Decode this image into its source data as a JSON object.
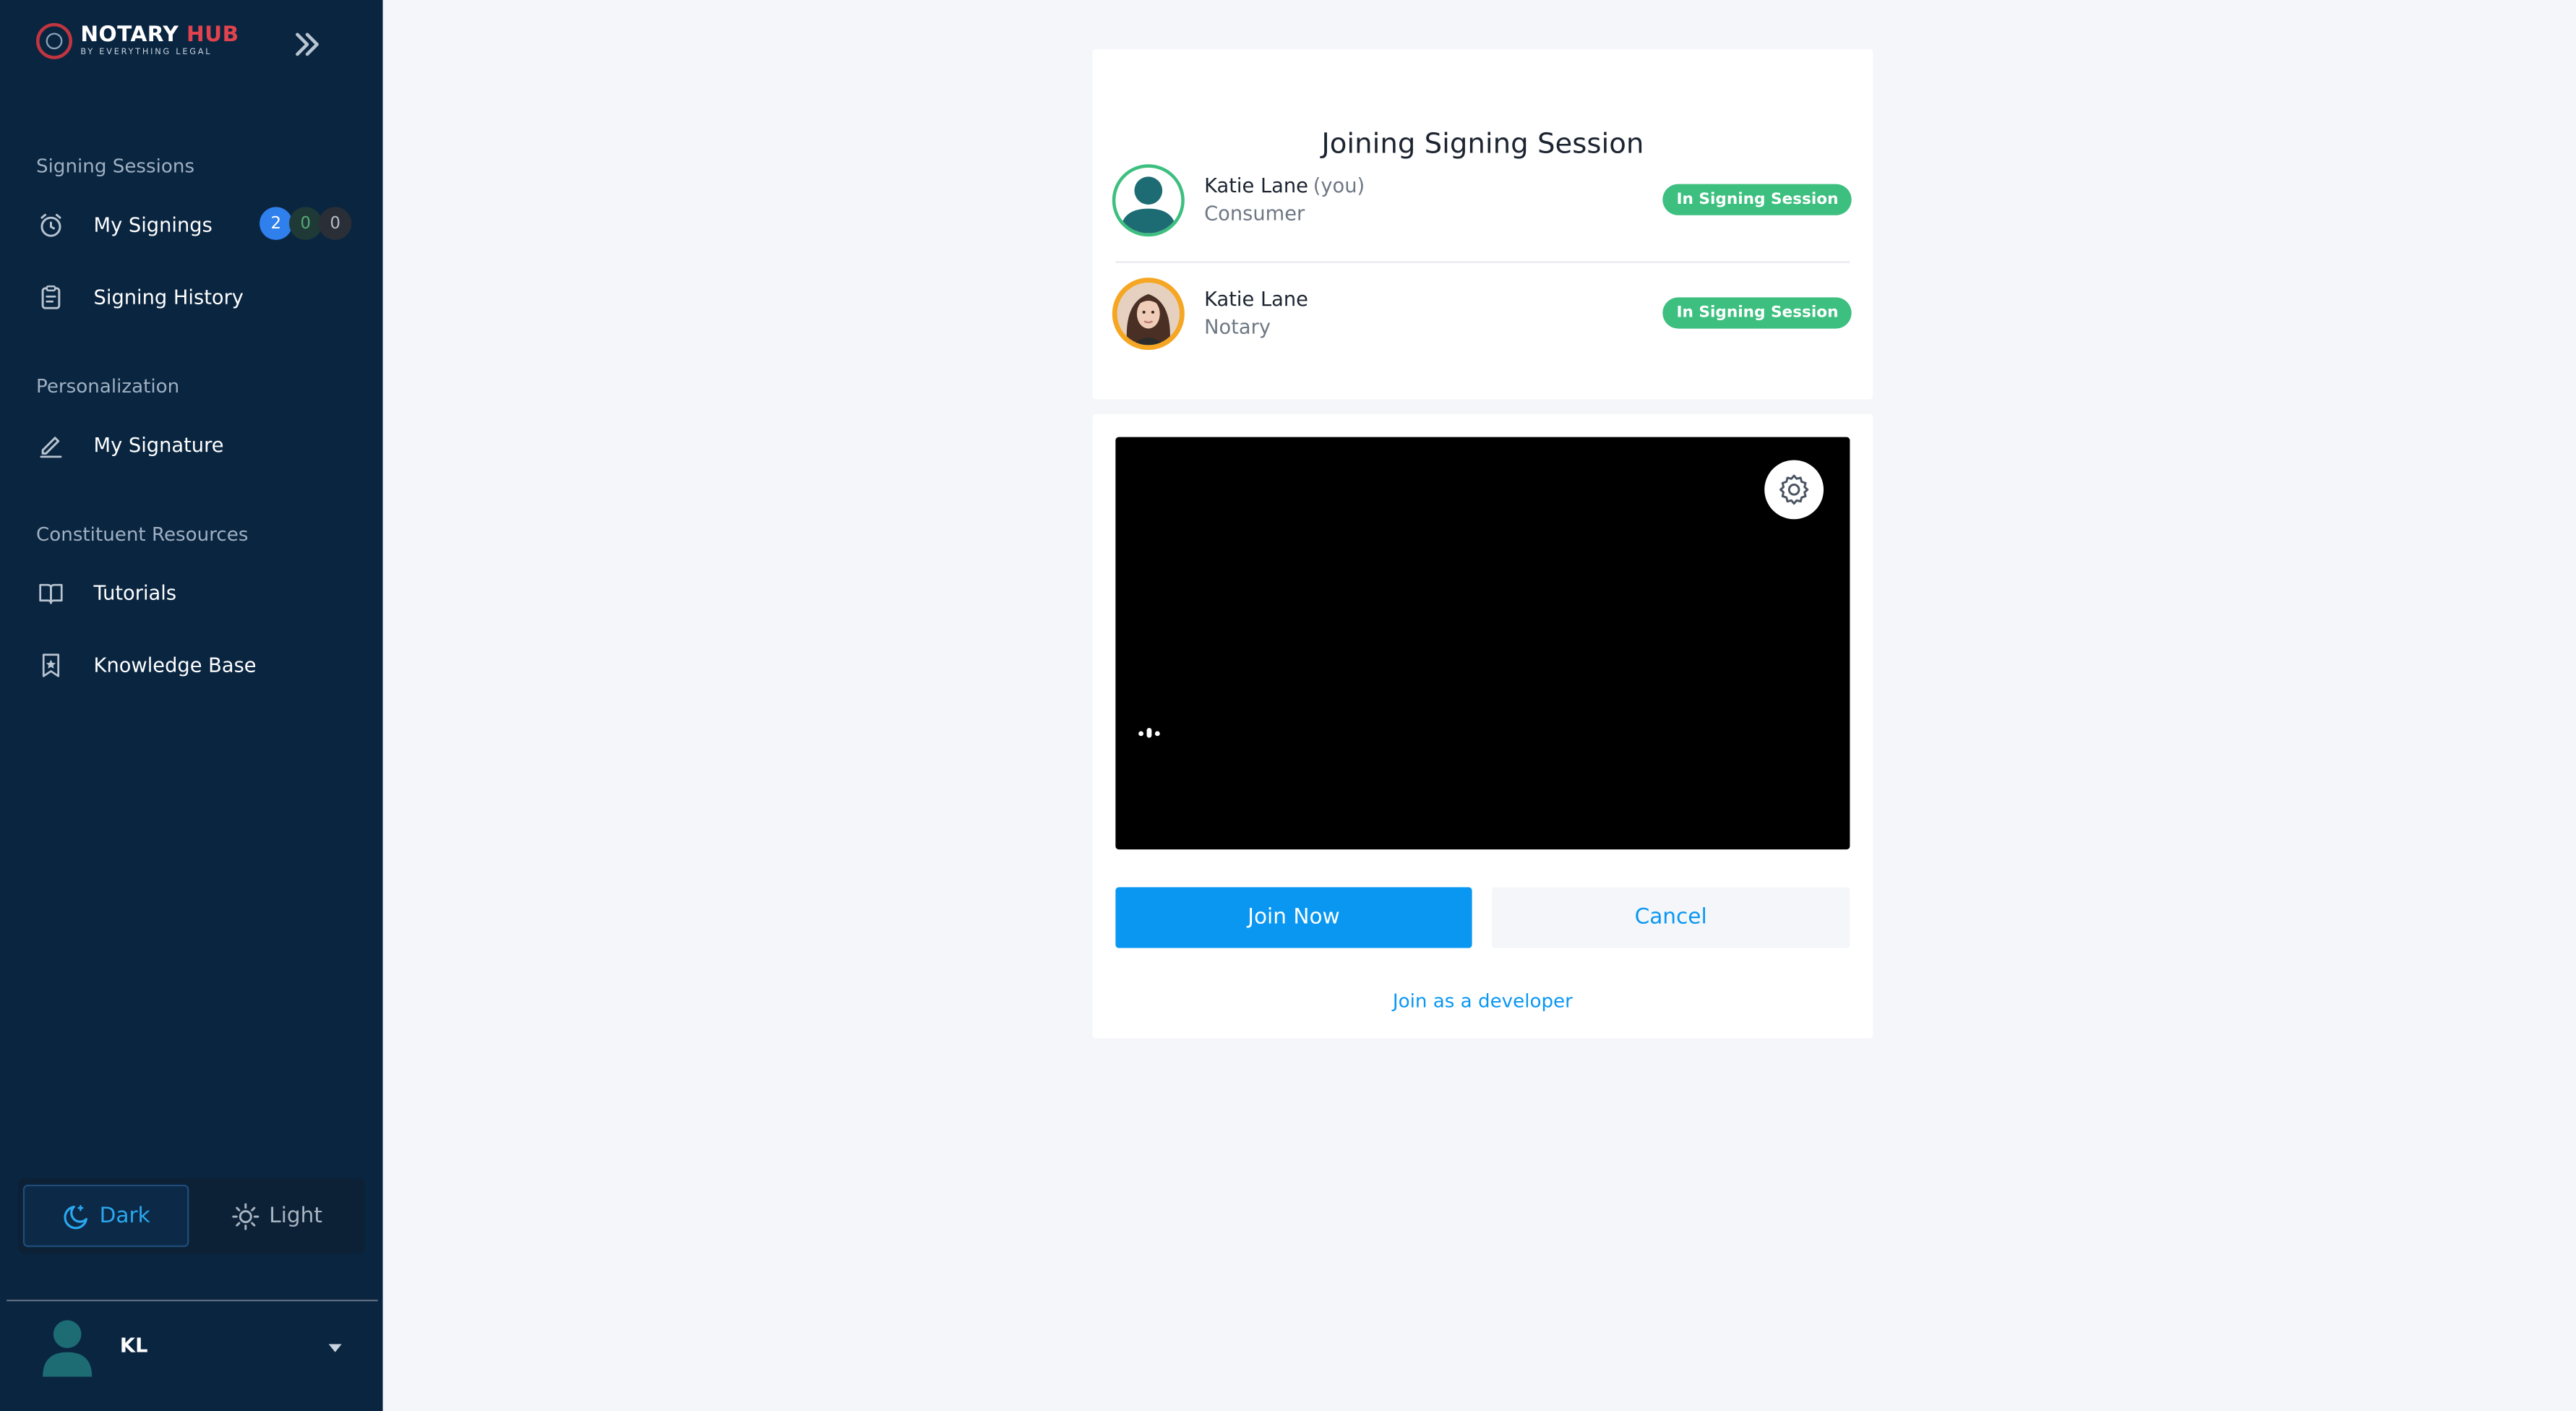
{
  "brand": {
    "name_main": "NOTARY",
    "name_accent": "HUB",
    "tagline": "BY EVERYTHING LEGAL",
    "accent_color": "#e0434e"
  },
  "sidebar": {
    "sections": [
      {
        "title": "Signing Sessions",
        "items": [
          {
            "label": "My Signings",
            "icon": "alarm-clock-icon",
            "counts": [
              "2",
              "0",
              "0"
            ]
          },
          {
            "label": "Signing History",
            "icon": "clipboard-icon"
          }
        ]
      },
      {
        "title": "Personalization",
        "items": [
          {
            "label": "My Signature",
            "icon": "pen-icon"
          }
        ]
      },
      {
        "title": "Constituent Resources",
        "items": [
          {
            "label": "Tutorials",
            "icon": "book-icon"
          },
          {
            "label": "Knowledge Base",
            "icon": "bookmark-star-icon"
          }
        ]
      }
    ],
    "theme": {
      "dark_label": "Dark",
      "light_label": "Light",
      "selected": "Dark"
    },
    "user": {
      "initials": "KL"
    }
  },
  "session": {
    "title": "Joining Signing Session",
    "participants": [
      {
        "name": "Katie Lane",
        "suffix": "(you)",
        "role": "Consumer",
        "status": "In Signing Session",
        "avatar": "default-avatar-icon"
      },
      {
        "name": "Katie Lane",
        "suffix": "",
        "role": "Notary",
        "status": "In Signing Session",
        "avatar": "notary-photo"
      }
    ],
    "join_label": "Join Now",
    "cancel_label": "Cancel",
    "developer_link": "Join as a developer"
  },
  "colors": {
    "sidebar_bg": "#0a2540",
    "primary": "#0a97f2",
    "status_green": "#3dbf7f",
    "notary_ring": "#f5a623"
  }
}
